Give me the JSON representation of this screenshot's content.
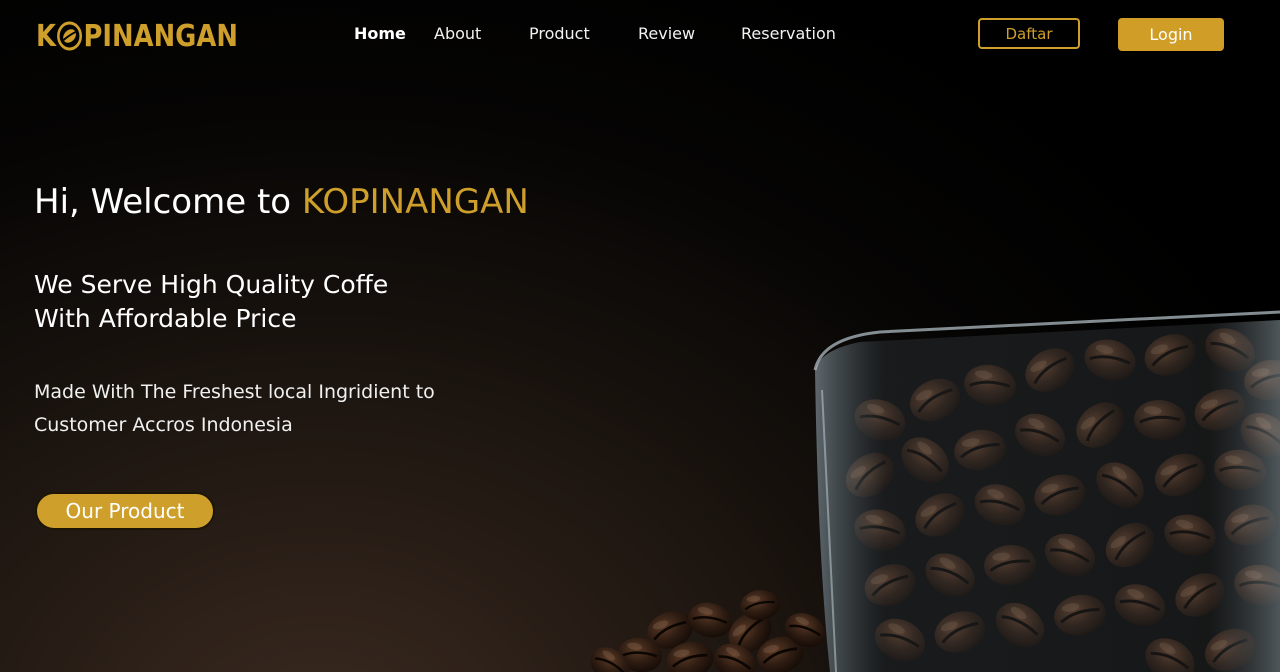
{
  "logo": {
    "text_prefix": "K",
    "text_suffix": "PINANGAN",
    "icon": "coffee-bean-icon",
    "color": "#cf9f2c"
  },
  "nav": {
    "items": [
      {
        "label": "Home",
        "active": true
      },
      {
        "label": "About",
        "active": false
      },
      {
        "label": "Product",
        "active": false
      },
      {
        "label": "Review",
        "active": false
      },
      {
        "label": "Reservation",
        "active": false
      }
    ]
  },
  "auth": {
    "register_label": "Daftar",
    "login_label": "Login"
  },
  "hero": {
    "title_prefix": "Hi, Welcome to ",
    "title_brand": "KOPINANGAN",
    "subtitle_line1": "We Serve High Quality Coffe",
    "subtitle_line2": "With Affordable Price",
    "desc_line1": "Made With The Freshest local Ingridient to",
    "desc_line2": "Customer Accros Indonesia",
    "cta_label": "Our Product",
    "image": "coffee-beans-in-glass"
  },
  "colors": {
    "accent": "#cf9f2c",
    "background": "#000000",
    "text": "#ffffff"
  }
}
